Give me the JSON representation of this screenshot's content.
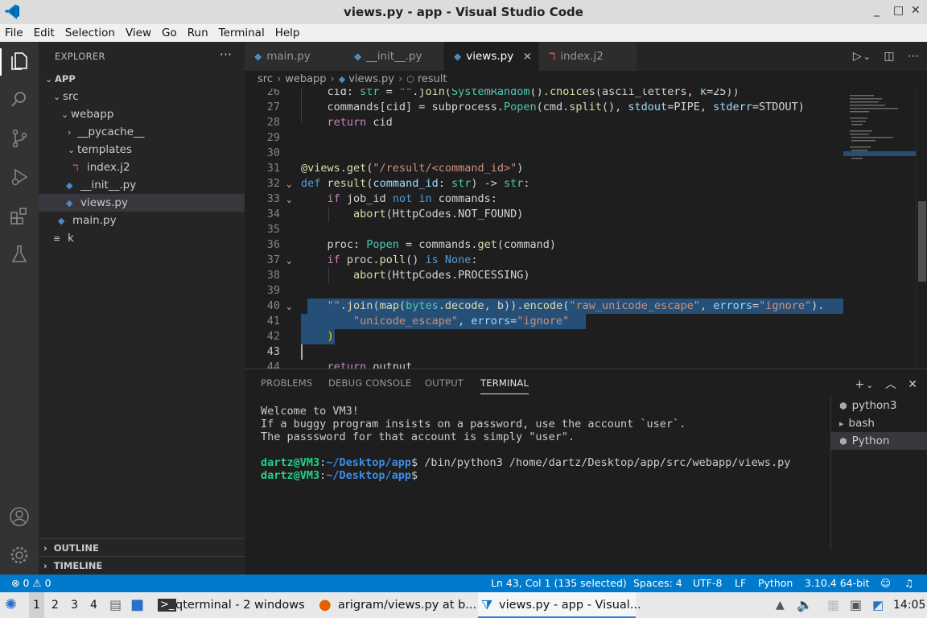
{
  "window": {
    "title": "views.py - app - Visual Studio Code",
    "controls": [
      "_",
      "□",
      "✕"
    ]
  },
  "menu": [
    "File",
    "Edit",
    "Selection",
    "View",
    "Go",
    "Run",
    "Terminal",
    "Help"
  ],
  "activity_bar": {
    "icons": [
      "explorer-icon",
      "search-icon",
      "source-control-icon",
      "run-debug-icon",
      "extensions-icon",
      "testing-icon",
      "account-icon",
      "manage-gear-icon"
    ]
  },
  "sidebar": {
    "title": "EXPLORER",
    "more": "···",
    "tree": [
      {
        "label": "APP",
        "depth": 0,
        "kind": "root",
        "chevron": "⌄"
      },
      {
        "label": "src",
        "depth": 1,
        "kind": "folder",
        "chevron": "⌄"
      },
      {
        "label": "webapp",
        "depth": 2,
        "kind": "folder",
        "chevron": "⌄"
      },
      {
        "label": "__pycache__",
        "depth": 3,
        "kind": "folder",
        "chevron": "›"
      },
      {
        "label": "templates",
        "depth": 3,
        "kind": "folder",
        "chevron": "⌄"
      },
      {
        "label": "index.j2",
        "depth": 4,
        "kind": "jinja"
      },
      {
        "label": "__init__.py",
        "depth": 3,
        "kind": "python"
      },
      {
        "label": "views.py",
        "depth": 3,
        "kind": "python",
        "selected": true
      },
      {
        "label": "main.py",
        "depth": 2,
        "kind": "python"
      },
      {
        "label": "k",
        "depth": 1,
        "kind": "text"
      }
    ],
    "sections": [
      "OUTLINE",
      "TIMELINE"
    ]
  },
  "tabs": [
    {
      "label": "main.py",
      "icon": "python",
      "active": false
    },
    {
      "label": "__init__.py",
      "icon": "python",
      "active": false
    },
    {
      "label": "views.py",
      "icon": "python",
      "active": true,
      "close": "×"
    },
    {
      "label": "index.j2",
      "icon": "jinja",
      "active": false
    }
  ],
  "breadcrumb": [
    "src",
    "webapp",
    "views.py",
    "result"
  ],
  "editor": {
    "lines": [
      {
        "n": "26",
        "text": "    cid: str = \"\".join(SystemRandom().choices(ascii_letters, k=25))"
      },
      {
        "n": "27",
        "text": "    commands[cid] = subprocess.Popen(cmd.split(), stdout=PIPE, stderr=STDOUT)"
      },
      {
        "n": "28",
        "text": "    return cid"
      },
      {
        "n": "29",
        "text": ""
      },
      {
        "n": "30",
        "text": ""
      },
      {
        "n": "31",
        "text": "@views.get(\"/result/<command_id>\")"
      },
      {
        "n": "32",
        "text": "def result(command_id: str) -> str:"
      },
      {
        "n": "33",
        "text": "    if job_id not in commands:"
      },
      {
        "n": "34",
        "text": "        abort(HttpCodes.NOT_FOUND)"
      },
      {
        "n": "35",
        "text": ""
      },
      {
        "n": "36",
        "text": "    proc: Popen = commands.get(command)"
      },
      {
        "n": "37",
        "text": "    if proc.poll() is None:"
      },
      {
        "n": "38",
        "text": "        abort(HttpCodes.PROCESSING)"
      },
      {
        "n": "39",
        "text": ""
      },
      {
        "n": "40",
        "text": "    \"\".join(map(bytes.decode, b)).encode(\"raw_unicode_escape\", errors=\"ignore\")."
      },
      {
        "n": "41",
        "text": "        \"unicode_escape\", errors=\"ignore\""
      },
      {
        "n": "42",
        "text": "    )"
      },
      {
        "n": "43",
        "text": ""
      },
      {
        "n": "44",
        "text": "    return output"
      }
    ]
  },
  "panel": {
    "tabs": [
      "PROBLEMS",
      "DEBUG CONSOLE",
      "OUTPUT",
      "TERMINAL"
    ],
    "active_tab": "TERMINAL",
    "actions": [
      "+",
      "⌄",
      "︿",
      "✕"
    ],
    "terminal": {
      "welcome": [
        "Welcome to VM3!",
        "If a buggy program insists on a password, use the account `user`.",
        "The passsword for that account is simply \"user\"."
      ],
      "prompt_user": "dartz@VM3",
      "prompt_sep": ":",
      "prompt_path": "~/Desktop/app",
      "prompt_symbol": "$",
      "command": " /bin/python3 /home/dartz/Desktop/app/src/webapp/views.py"
    },
    "terminal_list": [
      "python3",
      "bash",
      "Python"
    ]
  },
  "statusbar": {
    "errors": "0",
    "warnings": "0",
    "position": "Ln 43, Col 1 (135 selected)",
    "spaces": "Spaces: 4",
    "encoding": "UTF-8",
    "eol": "LF",
    "language": "Python",
    "interpreter": "3.10.4 64-bit"
  },
  "taskbar": {
    "workspaces": [
      "1",
      "2",
      "3",
      "4"
    ],
    "tasks": [
      {
        "label": "qterminal - 2 windows"
      },
      {
        "label": "arigram/views.py at b..."
      },
      {
        "label": "views.py - app - Visual..."
      }
    ],
    "clock": "14:05"
  },
  "colors": {
    "accent": "#007acc",
    "selection": "#264f78",
    "keyword": "#569cd6",
    "string": "#ce9178",
    "function": "#dcdcaa"
  }
}
